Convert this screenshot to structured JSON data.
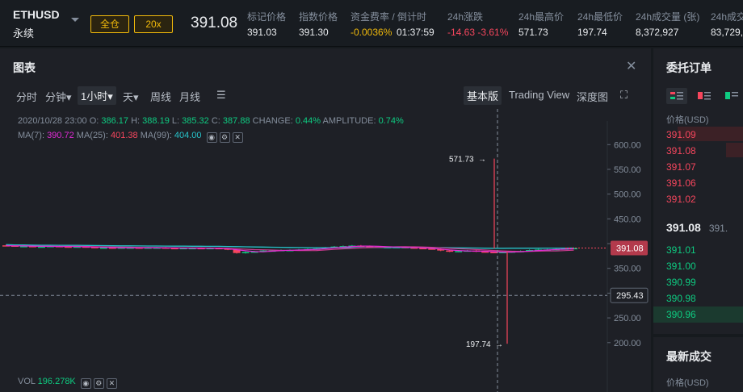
{
  "header": {
    "symbol": "ETHUSD",
    "contract_type": "永续",
    "margin_mode": "全仓",
    "leverage": "20x",
    "last_price": "391.08",
    "stats": [
      {
        "label": "标记价格",
        "value": "391.03"
      },
      {
        "label": "指数价格",
        "value": "391.30"
      },
      {
        "label": "资金费率 / 倒计时",
        "value": "-0.0036%",
        "value2": "01:37:59"
      },
      {
        "label": "24h涨跌",
        "value": "-14.63 -3.61%"
      },
      {
        "label": "24h最高价",
        "value": "571.73"
      },
      {
        "label": "24h最低价",
        "value": "197.74"
      },
      {
        "label": "24h成交量 (张)",
        "value": "8,372,927"
      },
      {
        "label": "24h成交",
        "value": "83,729,"
      }
    ]
  },
  "chart_panel": {
    "title": "图表",
    "toolbar": [
      "分时",
      "分钟▾",
      "1小时▾",
      "天▾",
      "周线",
      "月线"
    ],
    "views": [
      "基本版",
      "Trading View",
      "深度图"
    ],
    "ohlc": {
      "date": "2020/10/28 23:00",
      "O": "386.17",
      "H": "388.19",
      "L": "385.32",
      "C": "387.88",
      "change": "0.44%",
      "amplitude": "0.74%"
    },
    "ma": {
      "ma7": "390.72",
      "ma25": "401.38",
      "ma99": "404.00"
    },
    "vol": "196.278K",
    "labels": {
      "o": "O:",
      "h": "H:",
      "l": "L:",
      "c": "C:",
      "change": "CHANGE:",
      "amplitude": "AMPLITUDE:",
      "ma7": "MA(7):",
      "ma25": "MA(25):",
      "ma99": "MA(99):",
      "vol": "VOL"
    },
    "high_marker": "571.73",
    "low_marker": "197.74",
    "current_price_tag": "391.08",
    "crosshair_tag": "295.43"
  },
  "chart_data": {
    "type": "candlestick",
    "y_axis_ticks": [
      "600.00",
      "550.00",
      "500.00",
      "450.00",
      "400.00",
      "350.00",
      "300.00",
      "250.00",
      "200.00"
    ],
    "ylim": [
      185,
      620
    ],
    "close_series": [
      396,
      395,
      395,
      394,
      394,
      395,
      394,
      393,
      394,
      393,
      392,
      392,
      391,
      392,
      392,
      391,
      392,
      392,
      391,
      390,
      391,
      391,
      390,
      391,
      390,
      388,
      381,
      383,
      384,
      386,
      386,
      387,
      387,
      388,
      389,
      390,
      392,
      394,
      395,
      396,
      395,
      394,
      393,
      393,
      393,
      392,
      391,
      390,
      389,
      386,
      384,
      385,
      386,
      384,
      383,
      382,
      383,
      384,
      385,
      387,
      388,
      388,
      389,
      390,
      391
    ],
    "high_low_event": {
      "high": 571.73,
      "low": 197.74
    },
    "colors": {
      "up": "#0ecb81",
      "down": "#f6465d",
      "ma7": "#e12bd6",
      "ma25": "#c93a8e",
      "ma99": "#27c2c9"
    }
  },
  "order_book": {
    "title": "委托订单",
    "price_header": "价格(USD)",
    "asks": [
      "391.09",
      "391.08",
      "391.07",
      "391.06",
      "391.02"
    ],
    "mid_price": "391.08",
    "mid_secondary": "391.",
    "bids": [
      "391.01",
      "391.00",
      "390.99",
      "390.98",
      "390.96"
    ]
  },
  "trades": {
    "title": "最新成交",
    "price_header": "价格(USD)"
  }
}
